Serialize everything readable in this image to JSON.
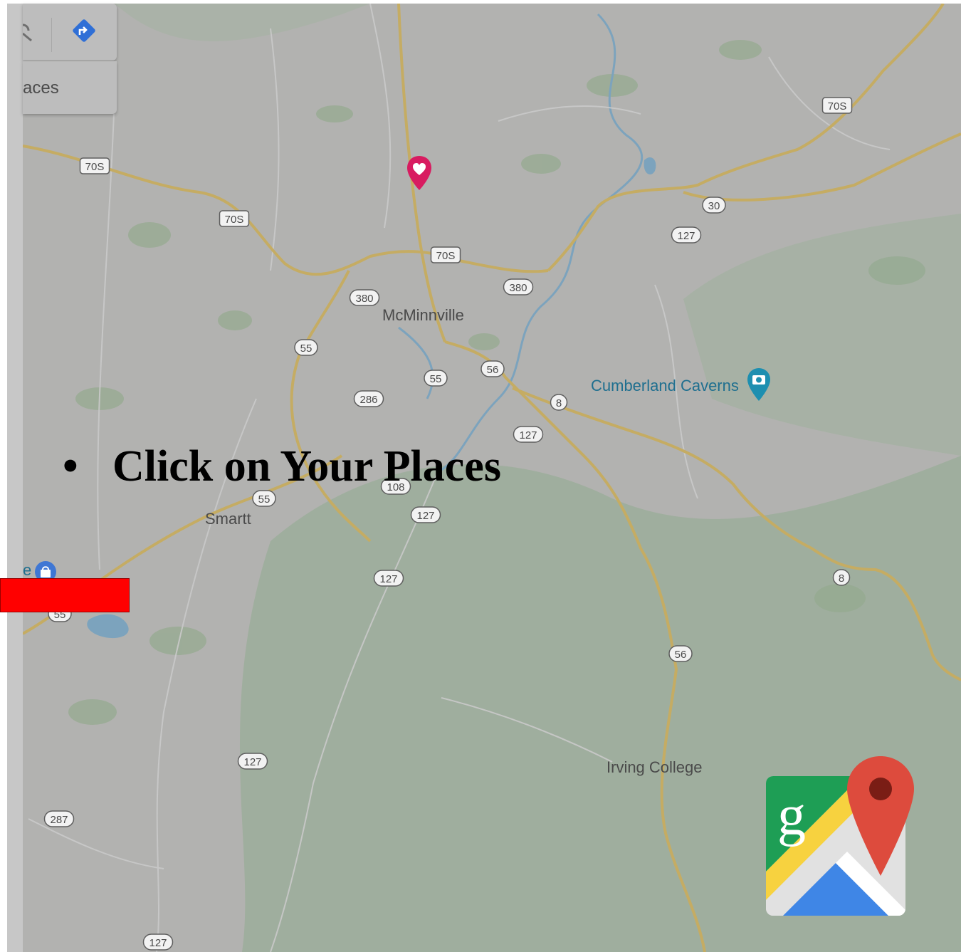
{
  "panel": {
    "places_partial_label": "aces"
  },
  "map": {
    "city_labels": [
      {
        "id": "mcminnville",
        "text": "McMinnville"
      },
      {
        "id": "smartt",
        "text": "Smartt"
      },
      {
        "id": "irving",
        "text": "Irving College"
      }
    ],
    "poi_labels": [
      {
        "id": "cumberland",
        "text": "Cumberland Caverns"
      },
      {
        "id": "partial-e",
        "text": "e"
      }
    ],
    "shields": [
      "70S",
      "70S",
      "70S",
      "70S",
      "30",
      "127",
      "380",
      "380",
      "55",
      "55",
      "56",
      "8",
      "286",
      "127",
      "108",
      "55",
      "127",
      "127",
      "8",
      "56",
      "127",
      "55",
      "287",
      "127"
    ]
  },
  "slide": {
    "bullet": "•",
    "text": "Click on Your Places"
  },
  "colors": {
    "road": "#e6c25a",
    "water": "#6da9d8",
    "land": "#b6b8b5",
    "forest": "#9ab59a",
    "pin_heart": "#d81b60",
    "accent_red": "#ff0000"
  },
  "icons": {
    "search": "search-icon",
    "directions": "directions-icon",
    "saved_pin": "heart-pin-icon",
    "camera_poi": "camera-poi-icon",
    "shopping_poi": "shopping-bag-poi-icon",
    "app_logo": "google-maps-logo-icon"
  }
}
